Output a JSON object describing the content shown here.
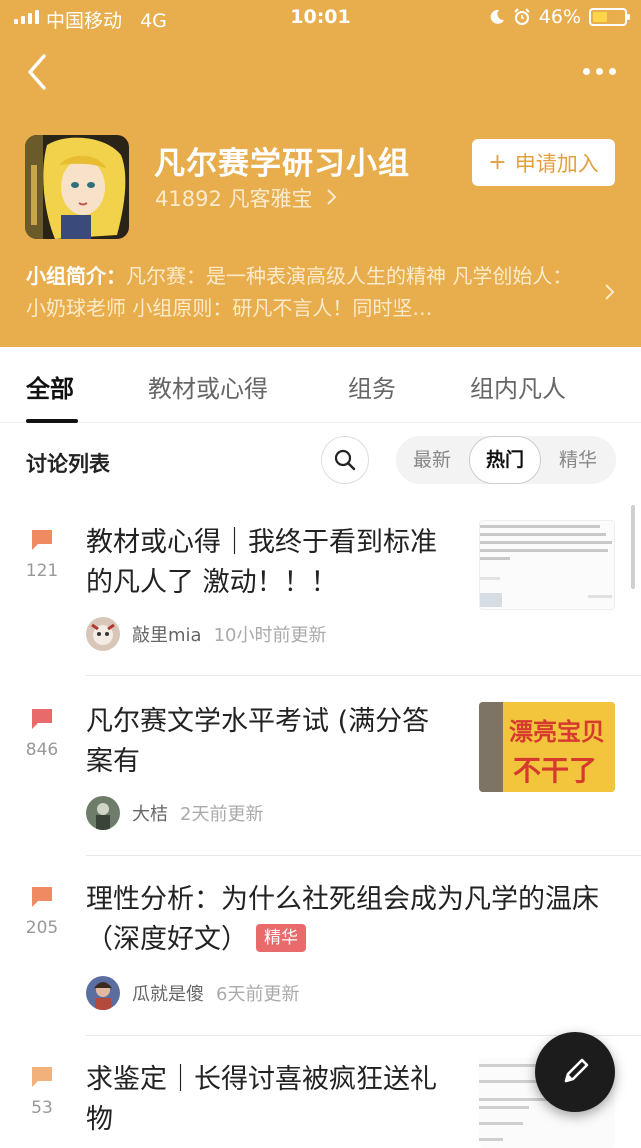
{
  "status_bar": {
    "carrier": "中国移动",
    "network": "4G",
    "time": "10:01",
    "battery": "46%"
  },
  "group": {
    "title": "凡尔赛学研习小组",
    "members": "41892 凡客雅宝",
    "join_label": "申请加入",
    "intro_label": "小组简介：",
    "intro_text": "凡尔赛：是一种表演高级人生的精神 凡学创始人：小奶球老师 小组原则：研凡不言人！同时坚…"
  },
  "tabs": [
    {
      "label": "全部",
      "active": true
    },
    {
      "label": "教材或心得"
    },
    {
      "label": "组务"
    },
    {
      "label": "组内凡人"
    }
  ],
  "toolbar": {
    "list_title": "讨论列表",
    "sort_options": [
      {
        "label": "最新"
      },
      {
        "label": "热门",
        "active": true
      },
      {
        "label": "精华"
      }
    ]
  },
  "posts": [
    {
      "count": "121",
      "title": "教材或心得｜我终于看到标准的凡人了 激动！！！",
      "author": "敲里mia",
      "time": "10小时前更新"
    },
    {
      "count": "846",
      "title": "凡尔赛文学水平考试 (满分答案有",
      "author": "大桔",
      "time": "2天前更新"
    },
    {
      "count": "205",
      "title": "理性分析：为什么社死组会成为凡学的温床（深度好文）",
      "badge": "精华",
      "author": "瓜就是傻",
      "time": "6天前更新"
    },
    {
      "count": "53",
      "title": "求鉴定｜长得讨喜被疯狂送礼物"
    }
  ],
  "thumb2_text": [
    "漂亮宝贝",
    "不干了"
  ],
  "colors": {
    "header": "#E8AE4E",
    "comment_icon": "#EF8A62",
    "badge": "#E86A6A",
    "join_text": "#E2A03F"
  }
}
